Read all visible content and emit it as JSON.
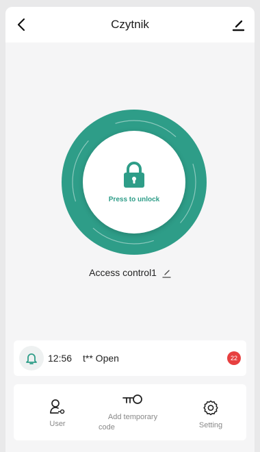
{
  "header": {
    "title": "Czytnik",
    "back_icon": "chevron-left-icon",
    "edit_icon": "edit-icon"
  },
  "lock": {
    "label": "Press to unlock",
    "icon": "lock-icon",
    "ring_color": "#2e9d88"
  },
  "device": {
    "name": "Access control1",
    "edit_icon": "pencil-icon"
  },
  "notification": {
    "icon": "bell-icon",
    "time": "12:56",
    "message": "t** Open",
    "badge_count": "22"
  },
  "actions": [
    {
      "label": "User",
      "icon": "user-key-icon"
    },
    {
      "label": "Add temporary code",
      "label_line1": "Add temporary",
      "label_line2": "code",
      "icon": "key-icon"
    },
    {
      "label": "Setting",
      "icon": "gear-icon"
    }
  ],
  "colors": {
    "accent": "#2e9d88",
    "badge": "#e74040"
  }
}
